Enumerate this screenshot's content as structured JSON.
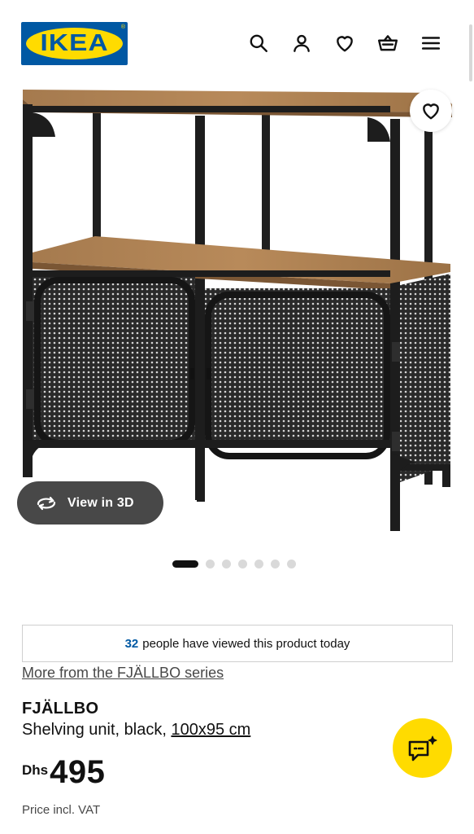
{
  "header": {
    "logo_text": "IKEA",
    "icons": [
      "search-icon",
      "user-icon",
      "heart-icon",
      "basket-icon",
      "menu-icon"
    ]
  },
  "gallery": {
    "view_3d_label": "View in 3D",
    "slide_count": 7,
    "active_slide": 1
  },
  "viewed": {
    "count": "32",
    "text": "people have viewed this product today"
  },
  "series_link": "More from the FJÄLLBO series",
  "product": {
    "name": "FJÄLLBO",
    "description": "Shelving unit, black,",
    "size": "100x95 cm",
    "currency": "Dhs",
    "price": "495",
    "price_note": "Price incl. VAT"
  },
  "colors": {
    "ikea_blue": "#0058a3",
    "ikea_yellow": "#ffdb00",
    "view3d_bg": "#484848"
  }
}
